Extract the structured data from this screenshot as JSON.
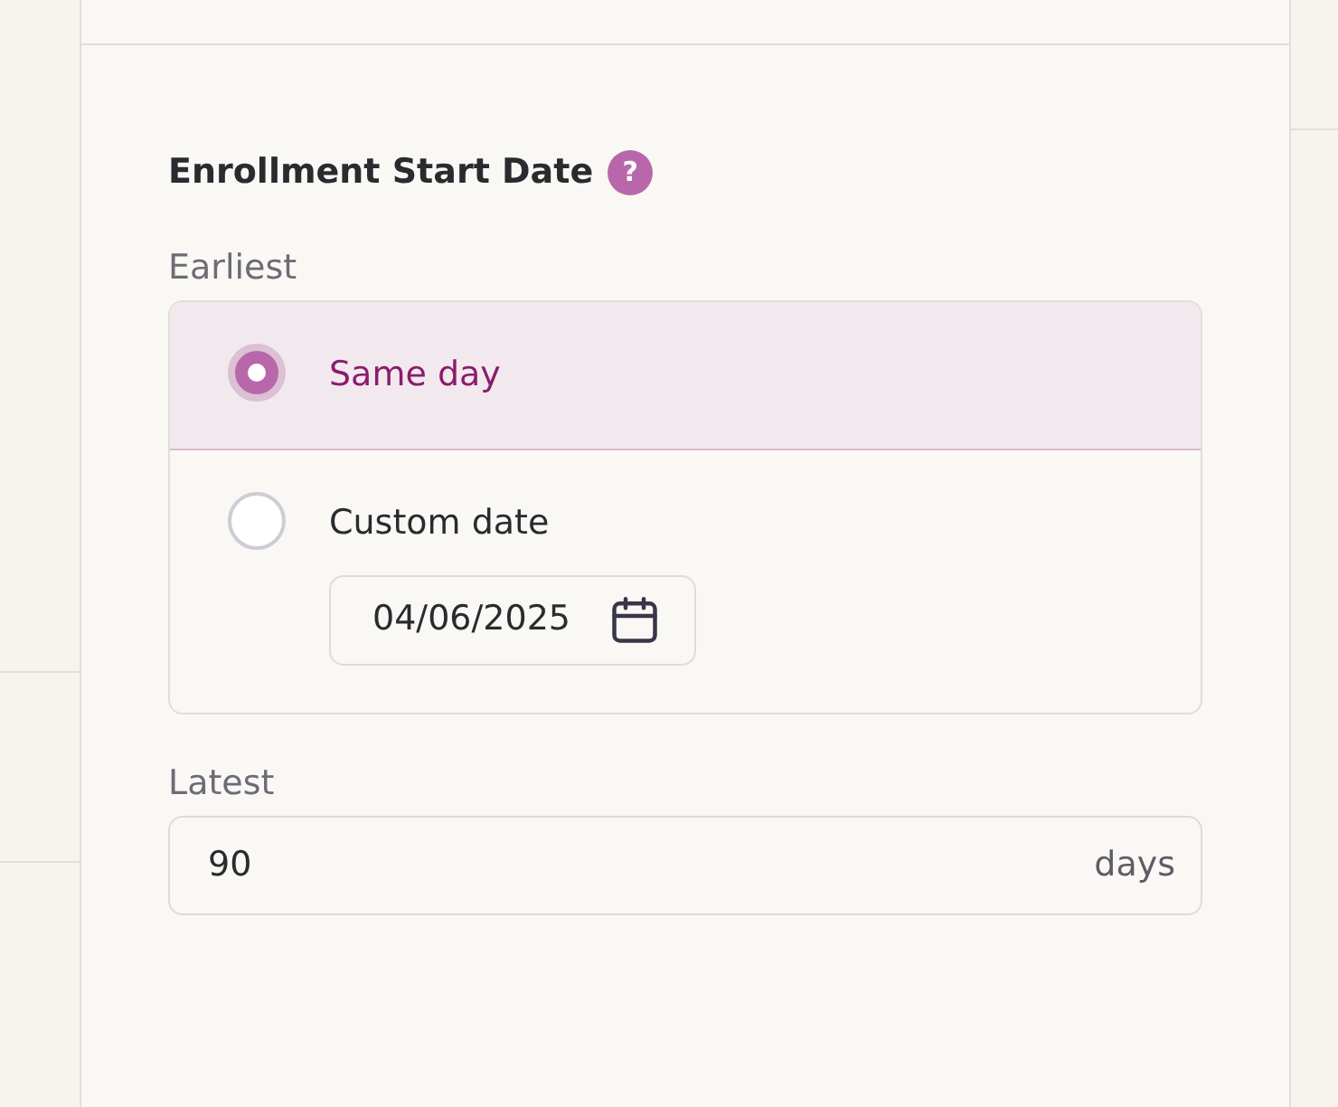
{
  "section": {
    "title": "Enrollment Start Date",
    "help": "?"
  },
  "earliest": {
    "label": "Earliest",
    "options": [
      {
        "label": "Same day",
        "selected": true
      },
      {
        "label": "Custom date",
        "selected": false,
        "date_value": "04/06/2025"
      }
    ]
  },
  "latest": {
    "label": "Latest",
    "value": "90",
    "suffix": "days"
  }
}
